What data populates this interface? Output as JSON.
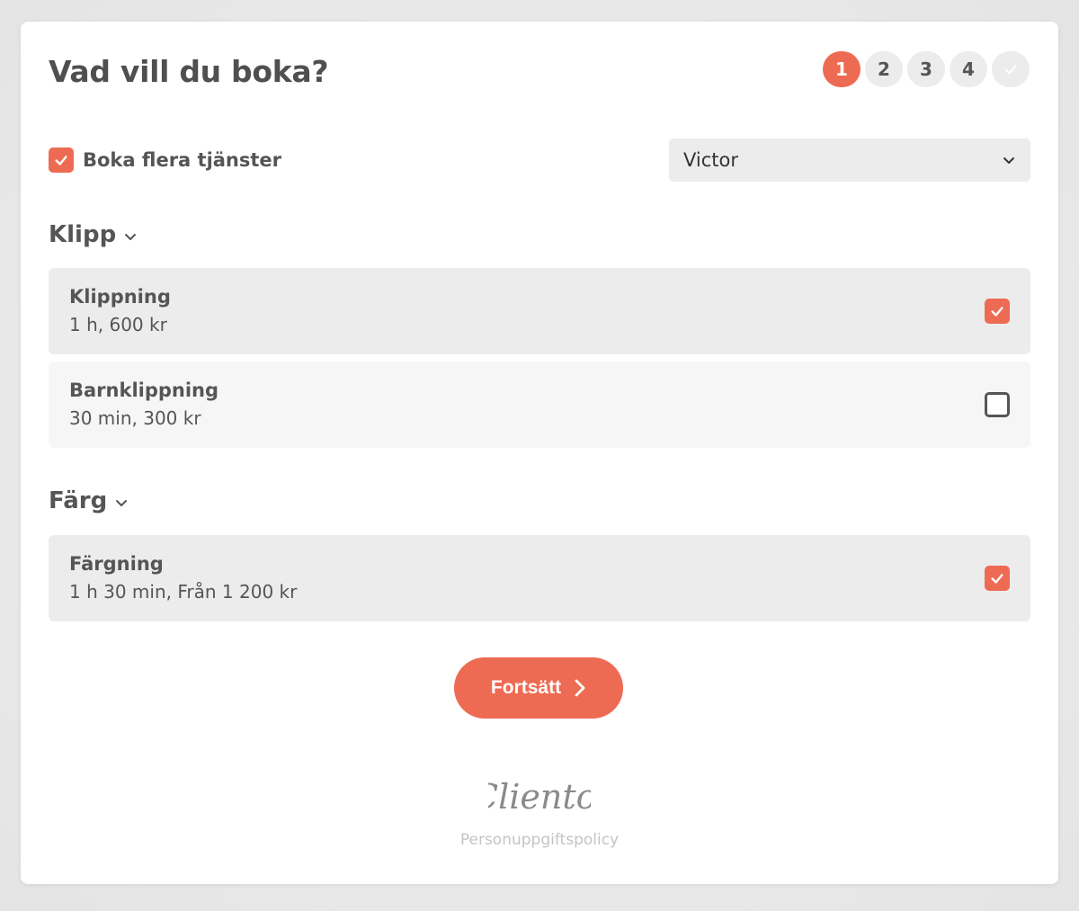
{
  "header": {
    "title": "Vad vill du boka?",
    "steps": [
      "1",
      "2",
      "3",
      "4"
    ],
    "active_step": "1"
  },
  "multi_booking": {
    "label": "Boka flera tjänster",
    "checked": true
  },
  "staff_select": {
    "value": "Victor"
  },
  "categories": [
    {
      "name": "Klipp",
      "services": [
        {
          "name": "Klippning",
          "meta": "1 h, 600 kr",
          "selected": true
        },
        {
          "name": "Barnklippning",
          "meta": "30 min, 300 kr",
          "selected": false
        }
      ]
    },
    {
      "name": "Färg",
      "services": [
        {
          "name": "Färgning",
          "meta": "1 h 30 min, Från 1 200 kr",
          "selected": true
        }
      ]
    }
  ],
  "actions": {
    "continue_label": "Fortsätt"
  },
  "footer": {
    "brand": "Cliento.",
    "policy_link": "Personuppgiftspolicy"
  },
  "colors": {
    "accent": "#ee6b53",
    "selected_bg": "#ececec",
    "unselected_bg": "#f6f6f6"
  },
  "icons": {
    "check": "check-icon",
    "chevron_down": "chevron-down-icon",
    "chevron_right": "chevron-right-icon"
  }
}
